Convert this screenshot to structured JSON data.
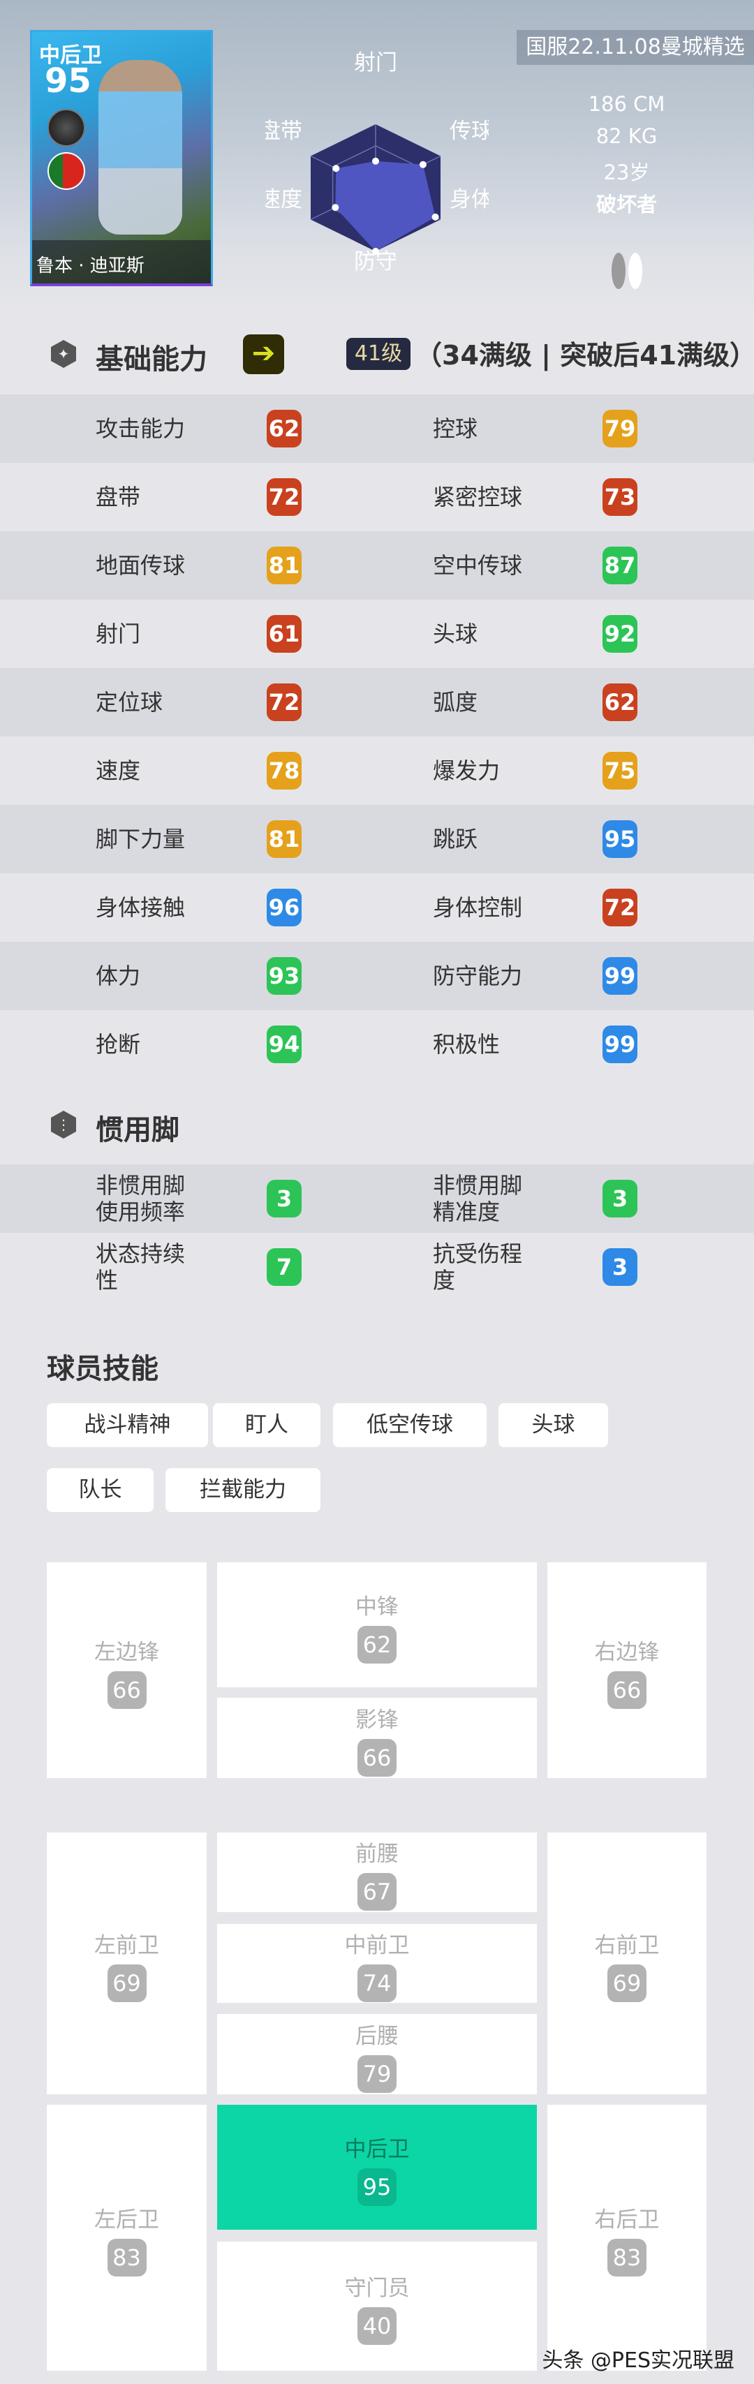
{
  "player": {
    "position": "中后卫",
    "overall": "95",
    "name": "鲁本 · 迪亚斯",
    "club_icon": "club-badge-icon",
    "flag_icon": "portugal-flag-icon"
  },
  "radar": {
    "axes": [
      {
        "label": "射门",
        "value": 42
      },
      {
        "label": "传球",
        "value": 73
      },
      {
        "label": "身体",
        "value": 92
      },
      {
        "label": "防守",
        "value": 100
      },
      {
        "label": "速度",
        "value": 62
      },
      {
        "label": "盘带",
        "value": 61
      }
    ],
    "fill": "#4f56c2",
    "bg": "#2d2f6b"
  },
  "version": "国服22.11.08曼城精选",
  "info": {
    "height": "186 CM",
    "weight": "82 KG",
    "age": "23岁",
    "style": "破坏者"
  },
  "basic": {
    "title": "基础能力",
    "level": "41级",
    "level_text": "（34满级 | 突破后41满级）",
    "stats": [
      [
        {
          "label": "攻击能力",
          "value": "62",
          "tier": "red"
        },
        {
          "label": "控球",
          "value": "79",
          "tier": "orange"
        }
      ],
      [
        {
          "label": "盘带",
          "value": "72",
          "tier": "red"
        },
        {
          "label": "紧密控球",
          "value": "73",
          "tier": "red"
        }
      ],
      [
        {
          "label": "地面传球",
          "value": "81",
          "tier": "orange"
        },
        {
          "label": "空中传球",
          "value": "87",
          "tier": "green"
        }
      ],
      [
        {
          "label": "射门",
          "value": "61",
          "tier": "red"
        },
        {
          "label": "头球",
          "value": "92",
          "tier": "green"
        }
      ],
      [
        {
          "label": "定位球",
          "value": "72",
          "tier": "red"
        },
        {
          "label": "弧度",
          "value": "62",
          "tier": "red"
        }
      ],
      [
        {
          "label": "速度",
          "value": "78",
          "tier": "orange"
        },
        {
          "label": "爆发力",
          "value": "75",
          "tier": "orange"
        }
      ],
      [
        {
          "label": "脚下力量",
          "value": "81",
          "tier": "orange"
        },
        {
          "label": "跳跃",
          "value": "95",
          "tier": "blue"
        }
      ],
      [
        {
          "label": "身体接触",
          "value": "96",
          "tier": "blue"
        },
        {
          "label": "身体控制",
          "value": "72",
          "tier": "red"
        }
      ],
      [
        {
          "label": "体力",
          "value": "93",
          "tier": "green"
        },
        {
          "label": "防守能力",
          "value": "99",
          "tier": "blue"
        }
      ],
      [
        {
          "label": "抢断",
          "value": "94",
          "tier": "green"
        },
        {
          "label": "积极性",
          "value": "99",
          "tier": "blue"
        }
      ]
    ]
  },
  "foot": {
    "title": "惯用脚",
    "stats": [
      [
        {
          "label": "非惯用脚\n使用频率",
          "value": "3",
          "tier": "green"
        },
        {
          "label": "非惯用脚\n精准度",
          "value": "3",
          "tier": "green"
        }
      ],
      [
        {
          "label": "状态持续\n性",
          "value": "7",
          "tier": "green"
        },
        {
          "label": "抗受伤程\n度",
          "value": "3",
          "tier": "blue"
        }
      ]
    ]
  },
  "skills": {
    "title": "球员技能",
    "items": [
      "战斗精神",
      "盯人",
      "低空传球",
      "头球",
      "队长",
      "拦截能力"
    ]
  },
  "positions": {
    "LWF": {
      "name": "左边锋",
      "value": "66"
    },
    "CF": {
      "name": "中锋",
      "value": "62"
    },
    "SS": {
      "name": "影锋",
      "value": "66"
    },
    "RWF": {
      "name": "右边锋",
      "value": "66"
    },
    "LMF": {
      "name": "左前卫",
      "value": "69"
    },
    "AMF": {
      "name": "前腰",
      "value": "67"
    },
    "CMF": {
      "name": "中前卫",
      "value": "74"
    },
    "DMF": {
      "name": "后腰",
      "value": "79"
    },
    "RMF": {
      "name": "右前卫",
      "value": "69"
    },
    "LB": {
      "name": "左后卫",
      "value": "83"
    },
    "CB": {
      "name": "中后卫",
      "value": "95"
    },
    "GK": {
      "name": "守门员",
      "value": "40"
    },
    "RB": {
      "name": "右后卫",
      "value": "83"
    }
  },
  "tiers": {
    "red": "#c9411f",
    "orange": "#e5a11b",
    "green": "#2cc456",
    "blue": "#2e8ae6"
  },
  "accent": "#0cd6a5",
  "watermark": "头条 @PES实况联盟"
}
